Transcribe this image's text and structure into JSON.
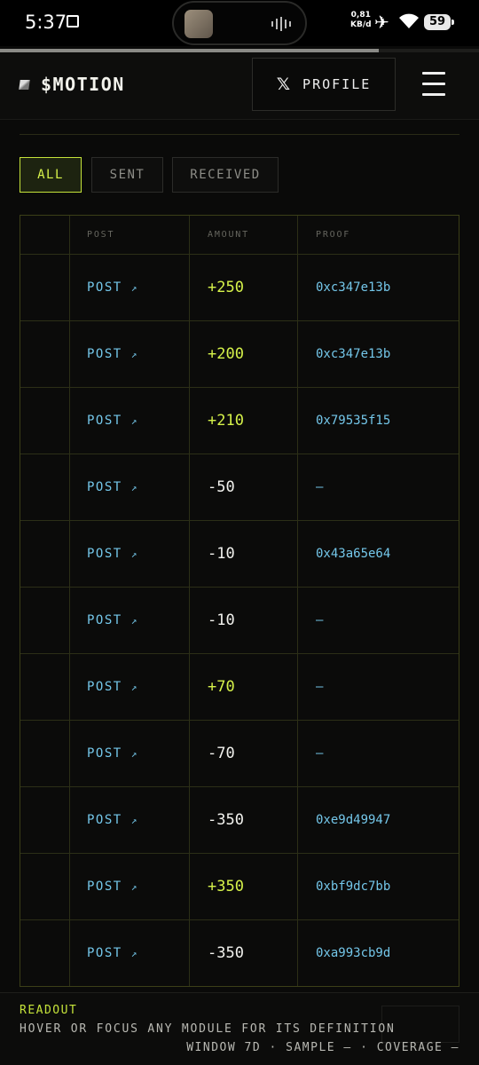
{
  "status_bar": {
    "time": "5:37",
    "net_speed_value": "0,81",
    "net_speed_unit": "KB/d",
    "battery": "59",
    "icons": [
      "screen-record-icon",
      "airplane-icon",
      "wifi-icon",
      "battery-icon"
    ],
    "progress_fraction": 0.79
  },
  "header": {
    "logo": "$MOTION",
    "profile_label": "PROFILE",
    "profile_icon": "x-logo-icon",
    "menu_icon": "hamburger-icon"
  },
  "filters": {
    "active": "ALL",
    "tabs": [
      "ALL",
      "SENT",
      "RECEIVED"
    ]
  },
  "table": {
    "columns": [
      "",
      "POST",
      "AMOUNT",
      "PROOF"
    ],
    "rows": [
      {
        "post": "POST",
        "arrow": "↗",
        "amount": "+250",
        "positive": true,
        "proof": "0xc347e13b"
      },
      {
        "post": "POST",
        "arrow": "↗",
        "amount": "+200",
        "positive": true,
        "proof": "0xc347e13b"
      },
      {
        "post": "POST",
        "arrow": "↗",
        "amount": "+210",
        "positive": true,
        "proof": "0x79535f15"
      },
      {
        "post": "POST",
        "arrow": "↗",
        "amount": "-50",
        "positive": false,
        "proof": "—"
      },
      {
        "post": "POST",
        "arrow": "↗",
        "amount": "-10",
        "positive": false,
        "proof": "0x43a65e64"
      },
      {
        "post": "POST",
        "arrow": "↗",
        "amount": "-10",
        "positive": false,
        "proof": "—"
      },
      {
        "post": "POST",
        "arrow": "↗",
        "amount": "+70",
        "positive": true,
        "proof": "—"
      },
      {
        "post": "POST",
        "arrow": "↗",
        "amount": "-70",
        "positive": false,
        "proof": "—"
      },
      {
        "post": "POST",
        "arrow": "↗",
        "amount": "-350",
        "positive": false,
        "proof": "0xe9d49947"
      },
      {
        "post": "POST",
        "arrow": "↗",
        "amount": "+350",
        "positive": true,
        "proof": "0xbf9dc7bb"
      },
      {
        "post": "POST",
        "arrow": "↗",
        "amount": "-350",
        "positive": false,
        "proof": "0xa993cb9d"
      }
    ]
  },
  "readout": {
    "title": "READOUT",
    "text": "HOVER OR FOCUS ANY MODULE FOR ITS DEFINITION",
    "window": "WINDOW 7D · SAMPLE — · COVERAGE —"
  },
  "colors": {
    "accent_lime": "#d6f24a",
    "link_blue": "#74c7ea",
    "background": "#0a0a09"
  }
}
